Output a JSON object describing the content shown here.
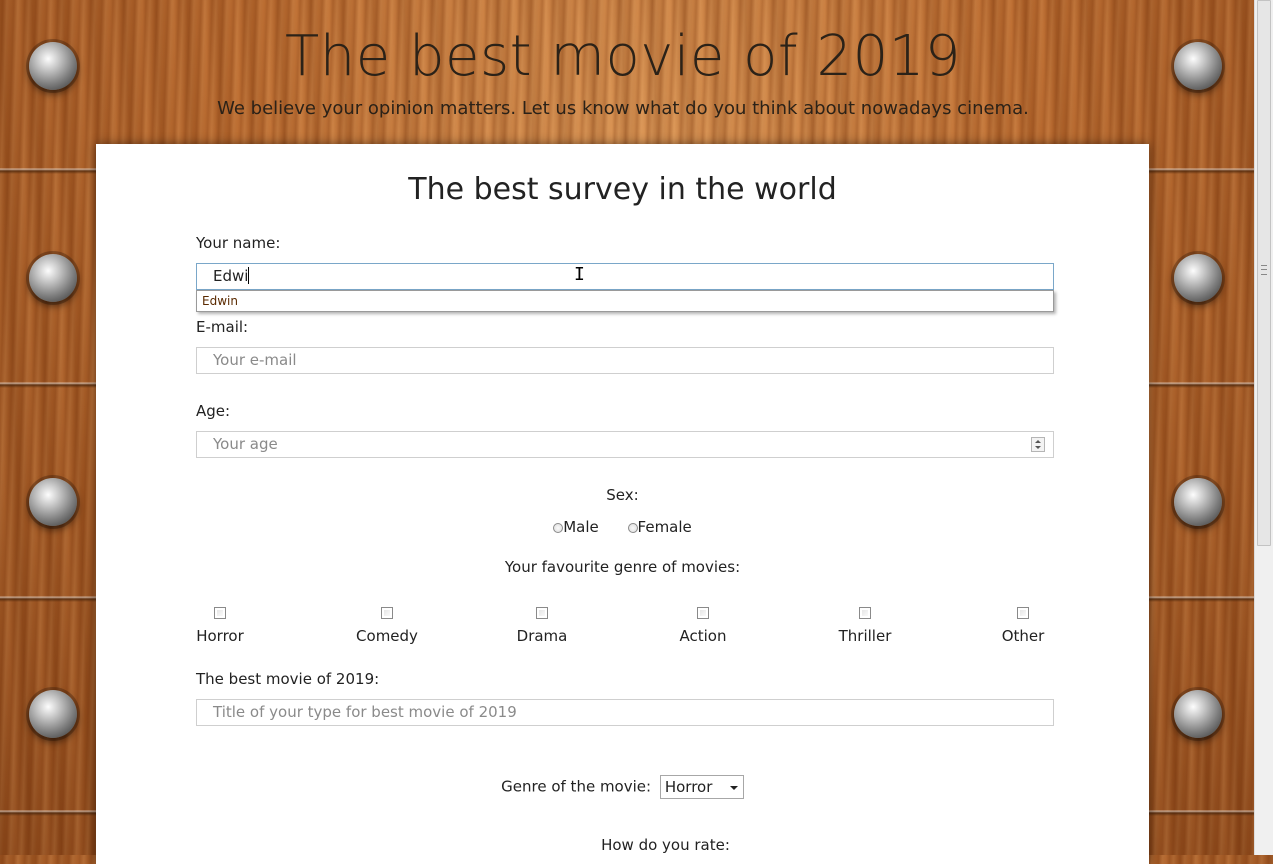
{
  "header": {
    "title": "The best movie of 2019",
    "subtitle": "We believe your opinion matters. Let us know what do you think about nowadays cinema."
  },
  "survey": {
    "title": "The best survey in the world",
    "name": {
      "label": "Your name:",
      "value": "Edwi",
      "suggestion": "Edwin"
    },
    "email": {
      "label": "E-mail:",
      "placeholder": "Your e-mail"
    },
    "age": {
      "label": "Age:",
      "placeholder": "Your age"
    },
    "sex": {
      "label": "Sex:",
      "options": [
        "Male",
        "Female"
      ]
    },
    "genres": {
      "label": "Your favourite genre of movies:",
      "options": [
        "Horror",
        "Comedy",
        "Drama",
        "Action",
        "Thriller",
        "Other"
      ]
    },
    "best_movie": {
      "label": "The best movie of 2019:",
      "placeholder": "Title of your type for best movie of 2019"
    },
    "movie_genre": {
      "label": "Genre of the movie:",
      "selected": "Horror"
    },
    "rate": {
      "label": "How do you rate:"
    }
  },
  "colors": {
    "card": "#ffffff",
    "focus_border": "#7aa7c9",
    "wood": "#b9682c"
  },
  "icons": [
    "rivet-icon",
    "spinner-icon",
    "dropdown-arrow-icon",
    "text-cursor-icon"
  ]
}
